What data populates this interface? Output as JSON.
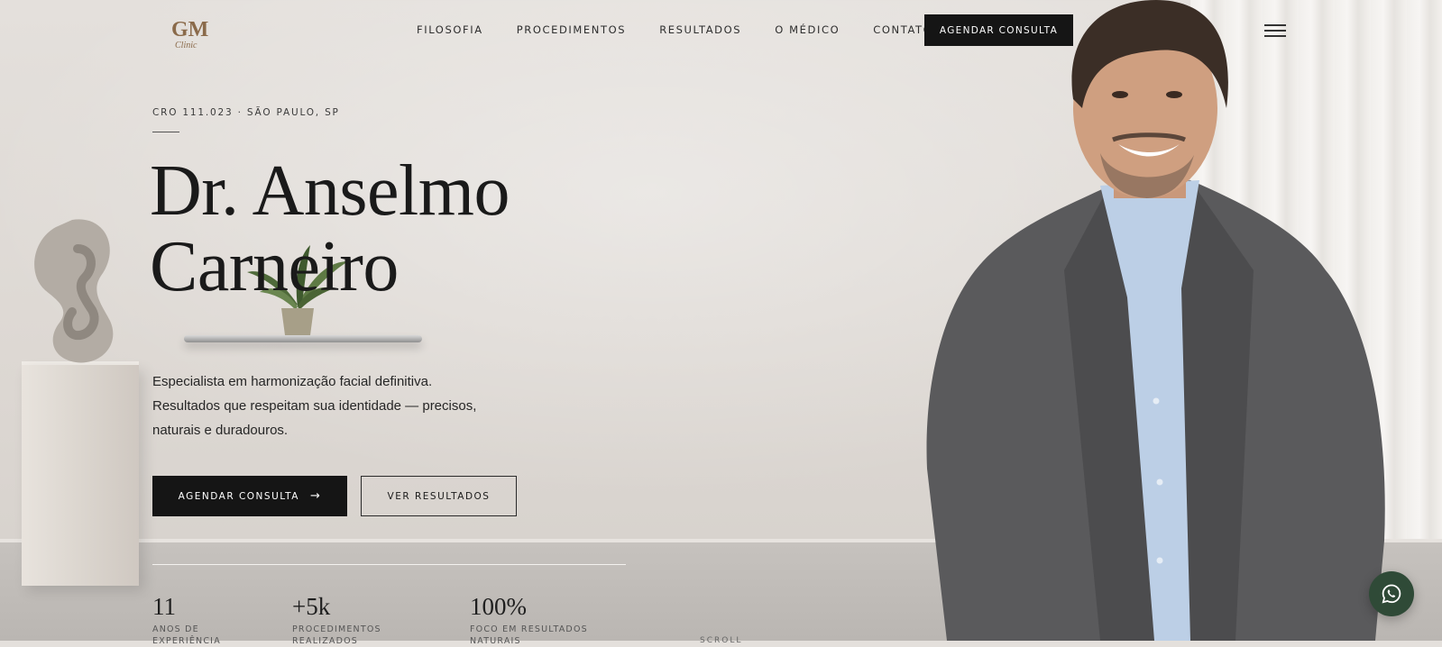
{
  "brand": {
    "logo_text": "GM",
    "logo_subtext": "Clinic"
  },
  "nav": {
    "items": [
      {
        "label": "FILOSOFIA"
      },
      {
        "label": "PROCEDIMENTOS"
      },
      {
        "label": "RESULTADOS"
      },
      {
        "label": "O MÉDICO"
      },
      {
        "label": "CONTATO"
      }
    ],
    "cta_label": "AGENDAR CONSULTA",
    "menu_icon": "hamburger-icon"
  },
  "hero": {
    "eyebrow": "CRO 111.023 · SÃO PAULO, SP",
    "title_line1": "Dr. Anselmo",
    "title_line2": "Carneiro",
    "lead_line1": "Especialista em harmonização facial definitiva.",
    "lead_line2": "Resultados que respeitam sua identidade — precisos,",
    "lead_line3": "naturais e duradouros.",
    "primary_label": "AGENDAR CONSULTA",
    "primary_icon": "arrow-right-icon",
    "secondary_label": "VER RESULTADOS"
  },
  "stats": [
    {
      "value": "11",
      "label": "ANOS DE EXPERIÊNCIA"
    },
    {
      "value": "+5k",
      "label": "PROCEDIMENTOS REALIZADOS"
    },
    {
      "value": "100%",
      "label": "FOCO EM RESULTADOS NATURAIS"
    }
  ],
  "scroll_label": "SCROLL",
  "whatsapp": {
    "icon": "whatsapp-icon"
  },
  "colors": {
    "accent": "#151515",
    "whatsapp_bg": "#2f4a37",
    "logo": "#8a6a4a"
  }
}
